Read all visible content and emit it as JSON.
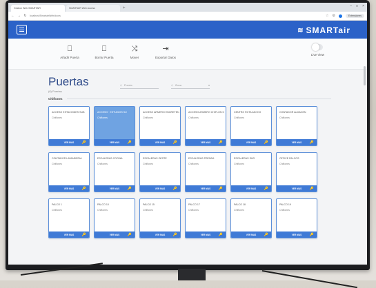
{
  "browser": {
    "tabs": [
      {
        "label": "Gestion Web SMARTAIR",
        "active": true
      },
      {
        "label": "SMARTAIR Web Access",
        "active": false
      }
    ],
    "new_tab": "+",
    "window_controls": [
      "–",
      "□",
      "×"
    ],
    "url": "localhost/SmartairWeb/doors",
    "extension_pill": "Extensiones"
  },
  "app": {
    "brand": "SMARTair",
    "brand_mark": "≋",
    "accent": "#2b62c8"
  },
  "toolbar": {
    "items": [
      {
        "icon": "add-door-icon",
        "glyph": "🚪",
        "label": "Añadir Puerta"
      },
      {
        "icon": "remove-door-icon",
        "glyph": "🚪",
        "label": "Borrar Puerta"
      },
      {
        "icon": "shuffle-icon",
        "glyph": "⤨",
        "label": "Mover"
      },
      {
        "icon": "export-icon",
        "glyph": "⇥",
        "label": "Exportar Datos"
      }
    ],
    "live_view": "Live View"
  },
  "page": {
    "title": "Puertas",
    "subtitle": "(6) Puertas",
    "filter_1": "Puerta",
    "filter_2": "Zona",
    "section": "Chiflones"
  },
  "cards": [
    {
      "name": "ACCESO ESTACIONES SUB",
      "zone": "Chiflones",
      "more": "VER MAS",
      "selected": false
    },
    {
      "name": "ACCESO · ESTUDIOS SU",
      "zone": "Chiflones",
      "more": "VER MAS",
      "selected": true
    },
    {
      "name": "ACCESO ARMERO ENGRETEN",
      "zone": "Chiflones",
      "more": "VER MAS",
      "selected": false
    },
    {
      "name": "ACCESO ARMERO CHIFLON 5",
      "zone": "Chiflones",
      "more": "VER MAS",
      "selected": false
    },
    {
      "name": "CENTRO RCTA ANCHO",
      "zone": "Chiflones",
      "more": "VER MAS",
      "selected": false
    },
    {
      "name": "CONTADOR ALMACEN",
      "zone": "Chiflones",
      "more": "VER MAS",
      "selected": false
    },
    {
      "name": "CONTADOR LAVANDERIA",
      "zone": "Chiflones",
      "more": "VER MAS",
      "selected": false
    },
    {
      "name": "ESCALERAS COCINA",
      "zone": "Chiflones",
      "more": "VER MAS",
      "selected": false
    },
    {
      "name": "ESCALERAS OESTE",
      "zone": "Chiflones",
      "more": "VER MAS",
      "selected": false
    },
    {
      "name": "ESCALERAS PRENSA",
      "zone": "Chiflones",
      "more": "VER MAS",
      "selected": false
    },
    {
      "name": "ESCALERAS SUR",
      "zone": "Chiflones",
      "more": "VER MAS",
      "selected": false
    },
    {
      "name": "OFFICE PALCOS",
      "zone": "Chiflones",
      "more": "VER MAS",
      "selected": false
    },
    {
      "name": "PALCO 1",
      "zone": "Chiflones",
      "more": "VER MAS",
      "selected": false
    },
    {
      "name": "PALCO 10",
      "zone": "Chiflones",
      "more": "VER MAS",
      "selected": false
    },
    {
      "name": "PALCO 15",
      "zone": "Chiflones",
      "more": "VER MAS",
      "selected": false
    },
    {
      "name": "PALCO 17",
      "zone": "Chiflones",
      "more": "VER MAS",
      "selected": false
    },
    {
      "name": "PALCO 18",
      "zone": "Chiflones",
      "more": "VER MAS",
      "selected": false
    },
    {
      "name": "PALCO 19",
      "zone": "Chiflones",
      "more": "VER MAS",
      "selected": false
    }
  ],
  "icons": {
    "card_action": "key-icon",
    "card_glyph": "🔑"
  }
}
